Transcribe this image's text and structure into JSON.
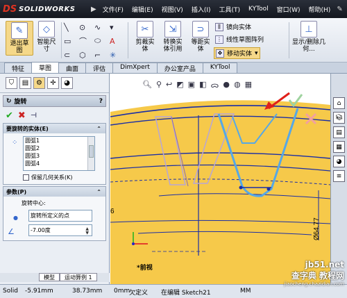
{
  "app": {
    "logo_mark": "DS",
    "logo_text": "SOLIDWORKS"
  },
  "menu": [
    "文件(F)",
    "编辑(E)",
    "视图(V)",
    "插入(I)",
    "工具(T)",
    "KYTool",
    "窗口(W)",
    "帮助(H)"
  ],
  "command_manager": {
    "exit_sketch": "退出草图",
    "smart_dim": "智能尺寸",
    "trim": "剪裁实体",
    "convert": "转换实体引用",
    "offset": "等距实体",
    "mirror": "镜向实体",
    "linear_pattern": "线性草图阵列",
    "move": "移动实体",
    "show_delete": "显示/删除几何..."
  },
  "tabs": [
    "特征",
    "草图",
    "曲面",
    "评估",
    "DimXpert",
    "办公室产品",
    "KYTool"
  ],
  "active_tab": "草图",
  "property_manager": {
    "title": "旋转",
    "help": "?",
    "entities_group": "要旋转的实体(E)",
    "entities": [
      "圆弧1",
      "圆弧2",
      "圆弧3",
      "圆弧4"
    ],
    "keep_relations": "保留几何关系(K)",
    "params_group": "参数(P)",
    "center_label": "旋转中心:",
    "center_value": "旋转所定义的点",
    "angle_value": "-7.00度"
  },
  "bottom_tabs": [
    "模型",
    "运动算例 1"
  ],
  "viewport": {
    "view_label": "*前视",
    "dim_right": "Ø64.77",
    "dim_left": "6"
  },
  "status": {
    "app": "Solid",
    "x": "-5.91mm",
    "y": "38.73mm",
    "z": "0mm",
    "state": "欠定义",
    "editing": "在编辑 Sketch21",
    "units": "MM"
  },
  "watermark": {
    "main": "查字典 教程网",
    "sub": "jiaocheng.chazidian.com",
    "site": "jb51.net"
  },
  "colors": {
    "accent": "#f5d889",
    "yellow": "#f6c94a",
    "sketch_blue": "#1a2ea6",
    "highlight_blue": "#56a8e6"
  }
}
